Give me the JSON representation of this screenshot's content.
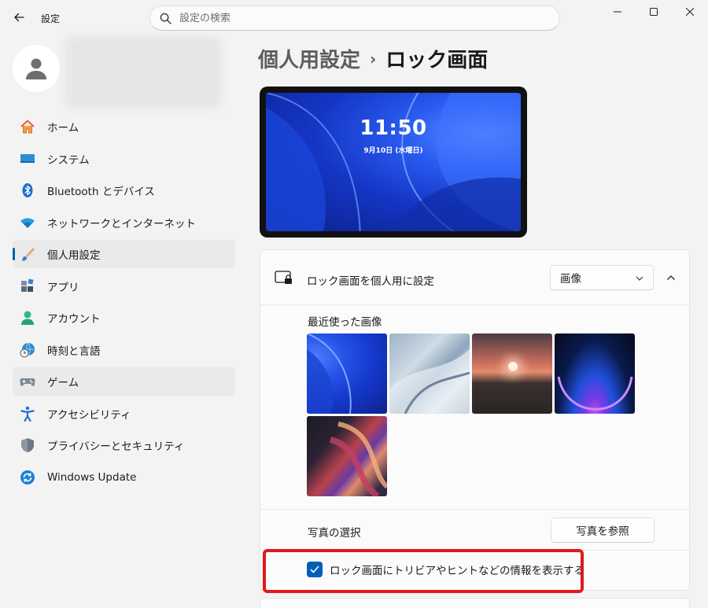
{
  "titlebar": {
    "app_title": "設定",
    "search_placeholder": "設定の検索"
  },
  "sidebar": {
    "items": [
      {
        "label": "ホーム",
        "icon": "home-icon"
      },
      {
        "label": "システム",
        "icon": "system-display-icon"
      },
      {
        "label": "Bluetooth とデバイス",
        "icon": "bluetooth-icon"
      },
      {
        "label": "ネットワークとインターネット",
        "icon": "wifi-icon"
      },
      {
        "label": "個人用設定",
        "icon": "paintbrush-icon",
        "active": true
      },
      {
        "label": "アプリ",
        "icon": "apps-icon"
      },
      {
        "label": "アカウント",
        "icon": "account-icon"
      },
      {
        "label": "時刻と言語",
        "icon": "globe-clock-icon"
      },
      {
        "label": "ゲーム",
        "icon": "gamepad-icon",
        "hover": true
      },
      {
        "label": "アクセシビリティ",
        "icon": "accessibility-icon"
      },
      {
        "label": "プライバシーとセキュリティ",
        "icon": "shield-icon"
      },
      {
        "label": "Windows Update",
        "icon": "update-icon"
      }
    ]
  },
  "breadcrumb": {
    "parent": "個人用設定",
    "separator": "›",
    "current": "ロック画面"
  },
  "preview": {
    "time": "11:50",
    "date": "9月10日 (水曜日)"
  },
  "lockscreen": {
    "label": "ロック画面を個人用に設定",
    "dropdown_value": "画像",
    "recent_label": "最近使った画像",
    "photo_label": "写真の選択",
    "browse_button": "写真を参照",
    "tips_label": "ロック画面にトリビアやヒントなどの情報を表示する",
    "tips_checked": true
  },
  "colors": {
    "accent": "#005fb8",
    "highlight": "#e0191c"
  }
}
